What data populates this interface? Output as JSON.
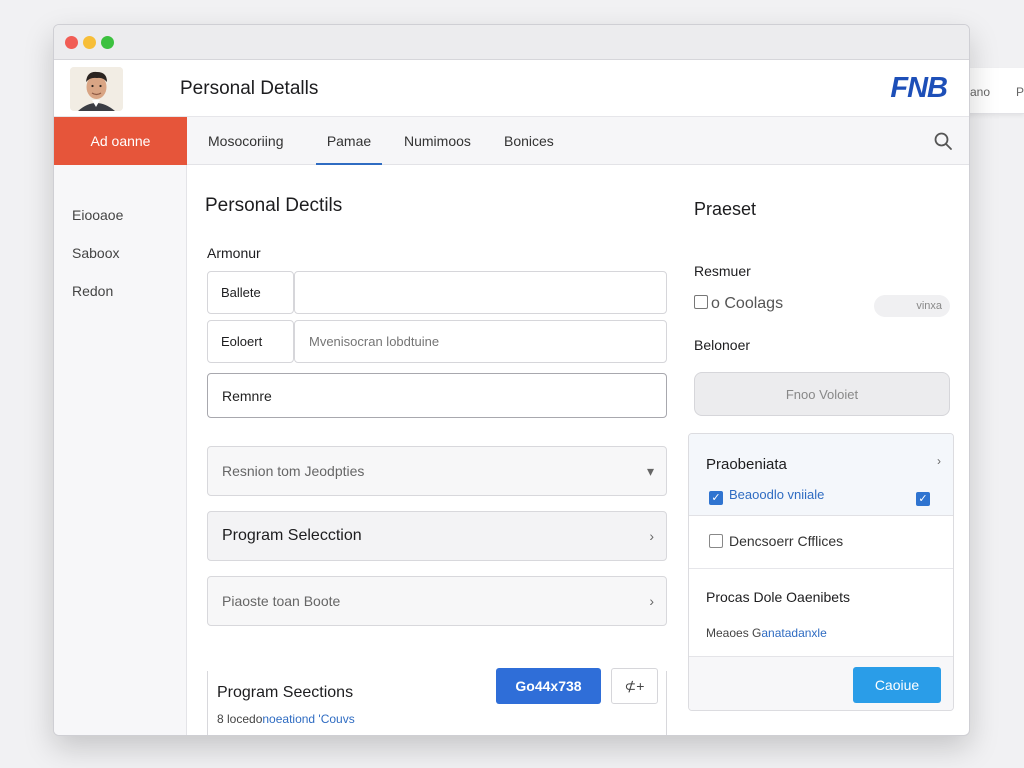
{
  "background_window": {
    "items": [
      "ano",
      "P"
    ]
  },
  "header": {
    "title": "Personal Detalls",
    "logo": "FNB"
  },
  "nav": {
    "brand": "Ad oanne",
    "tabs": [
      {
        "label": "Mosocoriing",
        "active": false
      },
      {
        "label": "Pamae",
        "active": true
      },
      {
        "label": "Numimoos",
        "active": false
      },
      {
        "label": "Bonices",
        "active": false
      }
    ]
  },
  "sidebar": {
    "items": [
      {
        "label": "Eiooaoe"
      },
      {
        "label": "Saboox"
      },
      {
        "label": "Redon"
      }
    ]
  },
  "main": {
    "title": "Personal Dectils",
    "section_label": "Armonur",
    "rows": [
      {
        "label": "Ballete",
        "value": "",
        "placeholder": ""
      },
      {
        "label": "Eoloert",
        "value": "",
        "placeholder": "Mvenisocran lobdtuine"
      }
    ],
    "full_input_value": "Remnre",
    "selects": [
      {
        "label": "Resnion tom Jeodpties",
        "chevron": "▾"
      },
      {
        "label": "Program Selecction",
        "chevron": "›"
      },
      {
        "label": "Piaoste toan Boote",
        "chevron": "›"
      }
    ],
    "program": {
      "title": "Program Seections",
      "link_prefix": "8 locedo",
      "link": "noeationd 'Couvs",
      "primary_button": "Go44x738",
      "icon_button": "⊄+"
    }
  },
  "right": {
    "title": "Praeset",
    "resume_label": "Resmuer",
    "check_label": "Coolags",
    "check_prefix": "o",
    "pill": "vinxa",
    "second_label": "Belonoer",
    "ghost_button": "Fnoo Voloiet",
    "panel": {
      "title": "Praobeniata",
      "chevron": "›",
      "check1": "Beaoodlo vniiale",
      "check2": "Dencsoerr Cfflices",
      "subsection_title": "Procas Dole Oaenibets",
      "link_prefix": "Meaoes G",
      "link": "anatadanxle",
      "continue_button": "Caoiue"
    }
  },
  "colors": {
    "brand_orange": "#e6553a",
    "primary_blue": "#2f6ed8",
    "continue_blue": "#2a9de8",
    "logo_blue": "#1d4fb8"
  }
}
